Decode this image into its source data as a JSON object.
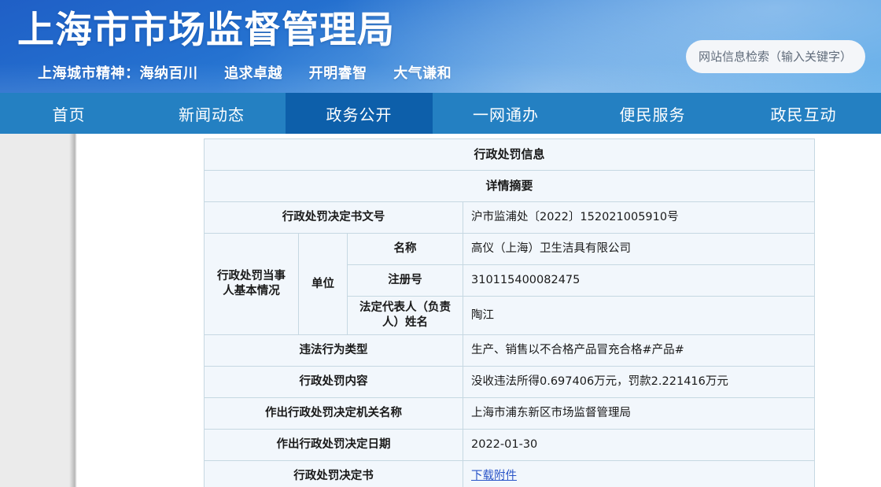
{
  "header": {
    "site_title": "上海市市场监督管理局",
    "slogan_prefix": "上海城市精神：海纳百川",
    "slogan_2": "追求卓越",
    "slogan_3": "开明睿智",
    "slogan_4": "大气谦和",
    "search_placeholder": "网站信息检索（输入关键字）",
    "search_value": ""
  },
  "nav": {
    "items": [
      {
        "label": "首页",
        "active": false
      },
      {
        "label": "新闻动态",
        "active": false
      },
      {
        "label": "政务公开",
        "active": true
      },
      {
        "label": "一网通办",
        "active": false
      },
      {
        "label": "便民服务",
        "active": false
      },
      {
        "label": "政民互动",
        "active": false
      }
    ]
  },
  "table": {
    "title": "行政处罚信息",
    "subtitle": "详情摘要",
    "doc_no_label": "行政处罚决定书文号",
    "doc_no_value": "沪市监浦处〔2022〕152021005910号",
    "party_label": "行政处罚当事人基本情况",
    "party_type_label": "单位",
    "party_name_label": "名称",
    "party_name_value": "高仪（上海）卫生洁具有限公司",
    "reg_no_label": "注册号",
    "reg_no_value": "310115400082475",
    "legal_rep_label": "法定代表人（负责人）姓名",
    "legal_rep_value": "陶江",
    "violation_type_label": "违法行为类型",
    "violation_type_value": "生产、销售以不合格产品冒充合格#产品#",
    "penalty_content_label": "行政处罚内容",
    "penalty_content_value": "没收违法所得0.697406万元，罚款2.221416万元",
    "authority_label": "作出行政处罚决定机关名称",
    "authority_value": "上海市浦东新区市场监督管理局",
    "decision_date_label": "作出行政处罚决定日期",
    "decision_date_value": "2022-01-30",
    "attachment_label": "行政处罚决定书",
    "attachment_link_text": "下载附件"
  },
  "colors": {
    "banner_start": "#1f5fc6",
    "banner_end": "#46a0e6",
    "nav_bg": "#2480c2",
    "nav_active_bg": "#0d5faa",
    "table_bg": "#f2f7fc",
    "table_border": "#c6d8e2",
    "link": "#2a55c8",
    "rail_bg": "#ebebeb"
  }
}
